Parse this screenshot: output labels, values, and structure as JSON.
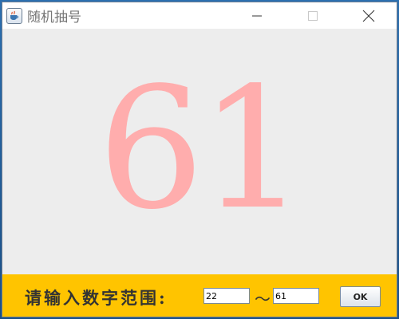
{
  "window": {
    "title": "随机抽号",
    "app_icon": "java-cup-icon",
    "controls": {
      "minimize_icon": "minimize-icon",
      "maximize_icon": "maximize-icon",
      "close_icon": "close-icon"
    }
  },
  "display": {
    "number": "61",
    "color": "#ffadad"
  },
  "range": {
    "label": "请输入数字范围:",
    "min_value": "22",
    "separator": "～",
    "max_value": "61",
    "ok_label": "OK",
    "bar_color": "#ffc400"
  }
}
